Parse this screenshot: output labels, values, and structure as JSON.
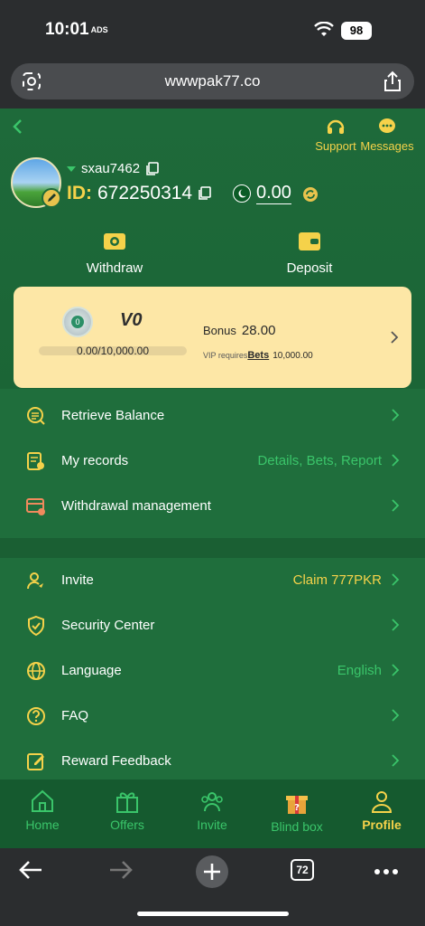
{
  "status": {
    "time": "10:01",
    "carrier": "ADS",
    "battery": "98"
  },
  "browser": {
    "url": "wwwpak77.co",
    "tabs_count": "72"
  },
  "header": {
    "support_label": "Support",
    "messages_label": "Messages"
  },
  "profile": {
    "username": "sxau7462",
    "id_label": "ID:",
    "id_value": "672250314",
    "balance": "0.00"
  },
  "actions": {
    "withdraw": "Withdraw",
    "deposit": "Deposit"
  },
  "vip": {
    "badge_number": "0",
    "level": "V0",
    "progress_text": "0.00/10,000.00",
    "progress_fraction": 0,
    "bonus_label": "Bonus",
    "bonus_value": "28.00",
    "requires_label": "VIP requires",
    "bets_label": "Bets",
    "requires_amount": "10,000.00"
  },
  "menu_primary": [
    {
      "label": "Retrieve Balance",
      "value": ""
    },
    {
      "label": "My records",
      "value": "Details, Bets, Report"
    },
    {
      "label": "Withdrawal management",
      "value": ""
    }
  ],
  "menu_secondary": [
    {
      "label": "Invite",
      "value": "Claim 777PKR"
    },
    {
      "label": "Security Center",
      "value": ""
    },
    {
      "label": "Language",
      "value": "English"
    },
    {
      "label": "FAQ",
      "value": ""
    },
    {
      "label": "Reward Feedback",
      "value": ""
    }
  ],
  "tabbar": [
    {
      "label": "Home",
      "icon": "home-icon"
    },
    {
      "label": "Offers",
      "icon": "gift-icon"
    },
    {
      "label": "Invite",
      "icon": "people-icon"
    },
    {
      "label": "Blind box",
      "icon": "blind-box-icon"
    },
    {
      "label": "Profile",
      "icon": "profile-icon"
    }
  ],
  "colors": {
    "primary_green": "#1f6e3c",
    "gold": "#f5d24a",
    "accent_green": "#3ac56a",
    "card": "#fde7a6"
  }
}
